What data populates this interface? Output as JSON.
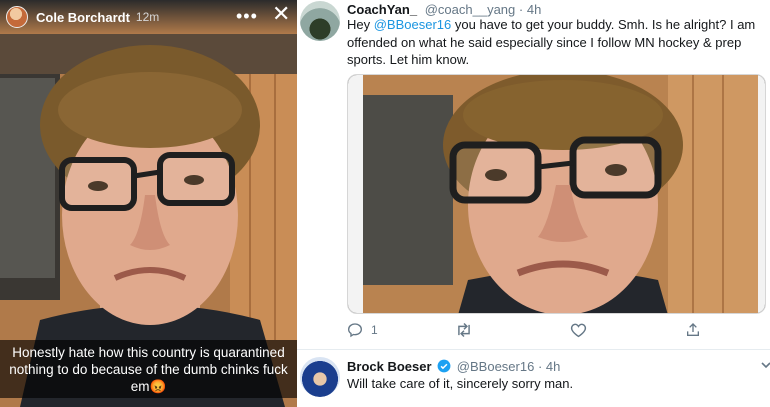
{
  "story": {
    "username": "Cole Borchardt",
    "timestamp": "12m",
    "more_label": "•••",
    "close_label": "✕",
    "caption": "Honestly hate how this country is quarantined nothing to do because of the dumb chinks fuck em😡"
  },
  "tweet1": {
    "display_name": "CoachYan_",
    "handle": "@coach__yang",
    "separator": "·",
    "time": "4h",
    "text_prefix": "Hey ",
    "mention": "@BBoeser16",
    "text_suffix": " you have to get your buddy. Smh. Is he alright? I am offended on what he said especially since I follow MN hockey & prep sports. Let him know.",
    "reply_count": "1"
  },
  "tweet2": {
    "display_name": "Brock Boeser",
    "handle": "@BBoeser16",
    "separator": "·",
    "time": "4h",
    "text": "Will take care of it, sincerely sorry man."
  },
  "icons": {
    "reply": "reply-icon",
    "retweet": "retweet-icon",
    "like": "heart-icon",
    "share": "share-icon",
    "verified": "verified-badge-icon",
    "caret": "chevron-down-icon"
  },
  "colors": {
    "twitter_blue": "#1b95e0",
    "verified_blue": "#1da1f2",
    "muted_gray": "#657786",
    "text_dark": "#14171a"
  }
}
